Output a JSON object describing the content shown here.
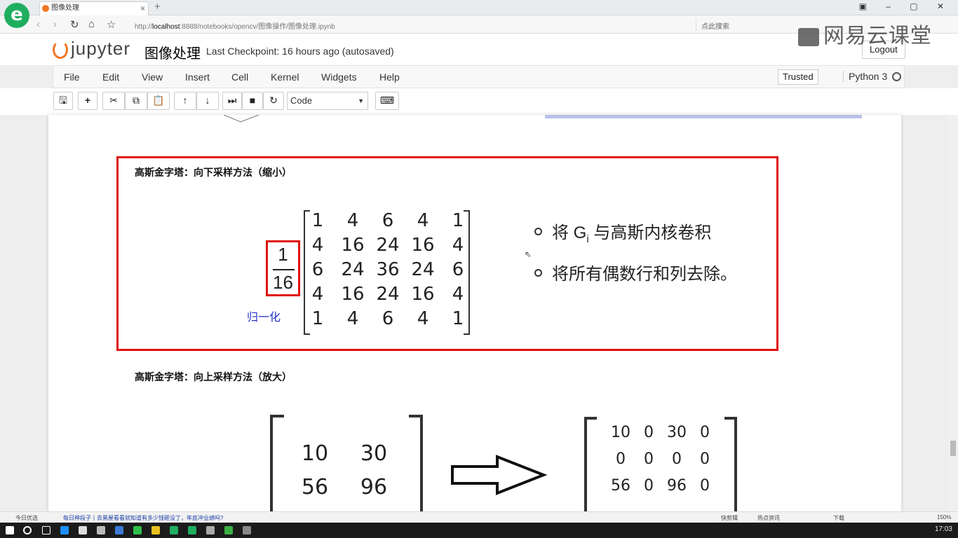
{
  "browser": {
    "tab_title": "图像处理",
    "url_prefix": "http://",
    "url_host": "localhost",
    "url_rest": ":8888/notebooks/opencv/图像操作/图像处理.ipynb",
    "search_placeholder": "点此搜索",
    "new_tab": "+",
    "window_controls": "▣ – ▢ ✕",
    "logo_letter": "e"
  },
  "watermark": "网易云课堂",
  "jupyter": {
    "logo_text": "jupyter",
    "notebook_name": "图像处理",
    "checkpoint": "Last Checkpoint: 16 hours ago (autosaved)",
    "logout": "Logout"
  },
  "menubar": {
    "items": [
      "File",
      "Edit",
      "View",
      "Insert",
      "Cell",
      "Kernel",
      "Widgets",
      "Help"
    ],
    "trusted": "Trusted",
    "kernel": "Python 3"
  },
  "toolbar": {
    "cell_type": "Code"
  },
  "cells": {
    "downsample_title": "高斯金字塔：向下采样方法（缩小）",
    "fraction_numerator": "1",
    "fraction_denominator": "16",
    "normalize_label": "归一化",
    "kernel_matrix": [
      [
        "1",
        "4",
        "6",
        "4",
        "1"
      ],
      [
        "4",
        "16",
        "24",
        "16",
        "4"
      ],
      [
        "6",
        "24",
        "36",
        "24",
        "6"
      ],
      [
        "4",
        "16",
        "24",
        "16",
        "4"
      ],
      [
        "1",
        "4",
        "6",
        "4",
        "1"
      ]
    ],
    "bullet1_pre": "将 G",
    "bullet1_sub": "i",
    "bullet1_post": " 与高斯内核卷积",
    "bullet2": "将所有偶数行和列去除。",
    "upsample_title": "高斯金字塔：向上采样方法（放大）",
    "input_matrix": [
      [
        "10",
        "30"
      ],
      [
        "56",
        "96"
      ]
    ],
    "output_matrix": [
      [
        "10",
        "0",
        "30",
        "0"
      ],
      [
        "0",
        "0",
        "0",
        "0"
      ],
      [
        "56",
        "0",
        "96",
        "0"
      ]
    ]
  },
  "statusbar": {
    "left_label": "今日优选",
    "news": "每日神段子丨去黑屋看看就知道有多少钱砸没了，年底冲业绩吗?",
    "right1": "快剪辑",
    "right2": "热点资讯",
    "download": "下载",
    "zoom": "150%"
  },
  "taskbar": {
    "clock": "17:03"
  }
}
